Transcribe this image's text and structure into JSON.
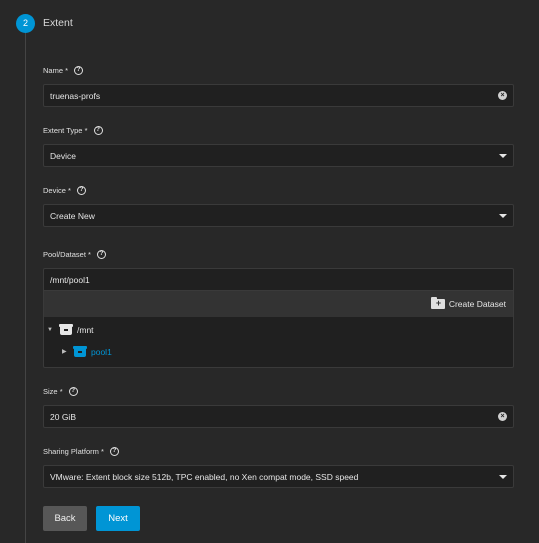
{
  "step": {
    "number": "2",
    "title": "Extent"
  },
  "fields": {
    "name": {
      "label": "Name",
      "required": "*",
      "value": "truenas-profs"
    },
    "extent_type": {
      "label": "Extent Type",
      "required": "*",
      "value": "Device"
    },
    "device": {
      "label": "Device",
      "required": "*",
      "value": "Create New"
    },
    "pool_dataset": {
      "label": "Pool/Dataset",
      "required": "*",
      "path": "/mnt/pool1",
      "create_dataset_label": "Create Dataset",
      "tree": [
        {
          "label": "/mnt",
          "expanded": true,
          "icon": "dataset-icon",
          "color": "#e6e6e6"
        },
        {
          "label": "pool1",
          "expanded": false,
          "icon": "dataset-icon",
          "color": "#0095d5"
        }
      ]
    },
    "size": {
      "label": "Size",
      "required": "*",
      "value": "20 GiB"
    },
    "sharing_platform": {
      "label": "Sharing Platform",
      "required": "*",
      "value": "VMware: Extent block size 512b, TPC enabled, no Xen compat mode, SSD speed"
    }
  },
  "buttons": {
    "back": "Back",
    "next": "Next"
  },
  "icons": {
    "help": "?",
    "clear": "×",
    "toggle_expanded": "▼",
    "toggle_collapsed": "▶",
    "plus": "+"
  },
  "colors": {
    "accent": "#0095d5",
    "back_button": "#575757",
    "background": "#282828"
  }
}
